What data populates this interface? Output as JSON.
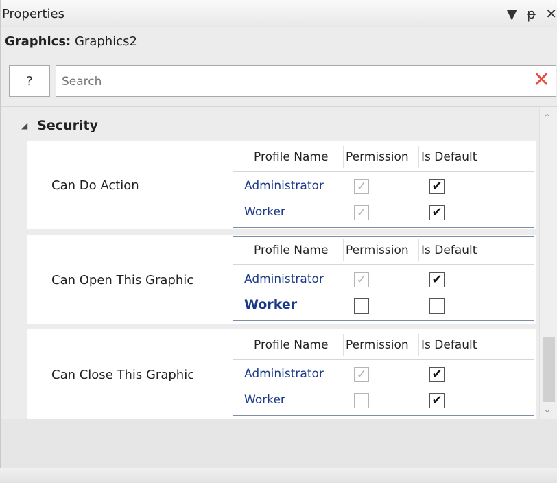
{
  "window": {
    "title": "Properties",
    "controls": {
      "menu": "▼",
      "pin": "ᵽ",
      "close": "✕"
    }
  },
  "object": {
    "type_label": "Graphics:",
    "name": "Graphics2"
  },
  "toolbar": {
    "help_label": "?",
    "search_placeholder": "Search",
    "clear_icon": "✕"
  },
  "category": {
    "label": "Security",
    "expanded_icon": "◢"
  },
  "columns": [
    "Profile Name",
    "Permission",
    "Is Default"
  ],
  "properties": [
    {
      "label": "Can Do Action",
      "profiles": [
        {
          "name": "Administrator",
          "permission": true,
          "permission_enabled": false,
          "is_default": true,
          "is_default_enabled": true,
          "bold": false
        },
        {
          "name": "Worker",
          "permission": true,
          "permission_enabled": false,
          "is_default": true,
          "is_default_enabled": true,
          "bold": false
        }
      ]
    },
    {
      "label": "Can Open This Graphic",
      "profiles": [
        {
          "name": "Administrator",
          "permission": true,
          "permission_enabled": false,
          "is_default": true,
          "is_default_enabled": true,
          "bold": false
        },
        {
          "name": "Worker",
          "permission": false,
          "permission_enabled": true,
          "is_default": false,
          "is_default_enabled": true,
          "bold": true
        }
      ]
    },
    {
      "label": "Can Close This Graphic",
      "profiles": [
        {
          "name": "Administrator",
          "permission": true,
          "permission_enabled": false,
          "is_default": true,
          "is_default_enabled": true,
          "bold": false
        },
        {
          "name": "Worker",
          "permission": false,
          "permission_enabled": false,
          "is_default": true,
          "is_default_enabled": true,
          "bold": false
        }
      ]
    }
  ],
  "scroll": {
    "up_icon": "⌃",
    "down_icon": "⌄"
  },
  "colors": {
    "profile_link": "#1b3a8a",
    "clear_icon": "#e84c3d"
  }
}
